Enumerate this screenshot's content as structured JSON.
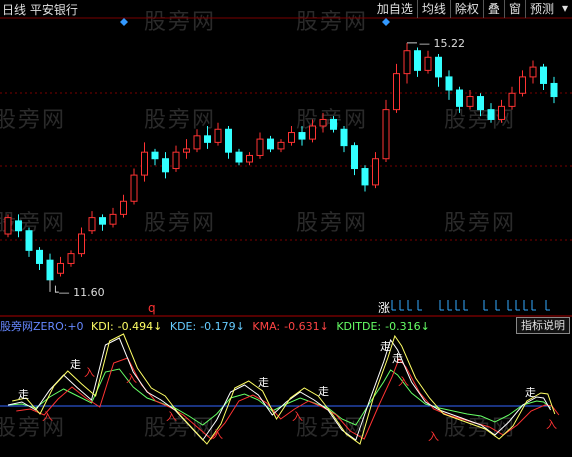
{
  "header": {
    "title": "日线  平安银行",
    "toolbar": [
      "加自选",
      "均线",
      "除权",
      "叠",
      "窗",
      "预测"
    ],
    "close_glyph": "▾"
  },
  "watermark_text": "股旁网",
  "price_labels": {
    "high": "15.22",
    "low": "11.60"
  },
  "markers": {
    "q_label": "q",
    "zhang_label": "涨"
  },
  "indicator": {
    "name": "股旁网ZERO:",
    "zero_value": "+0",
    "items": [
      {
        "label": "KDI:",
        "value": "-0.494",
        "arrow": "↓",
        "color": "#ffff66"
      },
      {
        "label": "KDE:",
        "value": "-0.179",
        "arrow": "↓",
        "color": "#66ccff"
      },
      {
        "label": "KMA:",
        "value": "-0.631",
        "arrow": "↓",
        "color": "#ff4444"
      },
      {
        "label": "KDITDE:",
        "value": "-0.316",
        "arrow": "↓",
        "color": "#66ff66"
      }
    ],
    "help_button": "指标说明",
    "signal_labels": {
      "sell": "走",
      "buy": "入"
    }
  },
  "colors": {
    "up": "#ff3333",
    "down": "#33ffff",
    "grid": "#7a0000",
    "kdi": "#ffff66",
    "kde": "#ffffff",
    "kma": "#ff3333",
    "kditde": "#66ff66",
    "zero": "#3366ff"
  },
  "chart_data": {
    "type": "candlestick",
    "ylim": [
      11.2,
      15.6
    ],
    "annotations": [
      {
        "text": "15.22",
        "value": 15.22
      },
      {
        "text": "11.60",
        "value": 11.6
      }
    ],
    "candles": [
      [
        12.3,
        12.55,
        12.25,
        12.6
      ],
      [
        12.5,
        12.35,
        12.25,
        12.6
      ],
      [
        12.35,
        12.05,
        11.95,
        12.4
      ],
      [
        12.05,
        11.85,
        11.75,
        12.1
      ],
      [
        11.9,
        11.6,
        11.6,
        12.0
      ],
      [
        11.7,
        11.85,
        11.65,
        11.95
      ],
      [
        11.85,
        12.0,
        11.8,
        12.05
      ],
      [
        12.0,
        12.3,
        11.95,
        12.4
      ],
      [
        12.35,
        12.55,
        12.3,
        12.65
      ],
      [
        12.55,
        12.45,
        12.35,
        12.6
      ],
      [
        12.45,
        12.6,
        12.4,
        12.7
      ],
      [
        12.6,
        12.8,
        12.55,
        12.9
      ],
      [
        12.8,
        13.2,
        12.75,
        13.3
      ],
      [
        13.2,
        13.55,
        13.1,
        13.7
      ],
      [
        13.55,
        13.45,
        13.35,
        13.6
      ],
      [
        13.45,
        13.25,
        13.15,
        13.55
      ],
      [
        13.3,
        13.55,
        13.25,
        13.65
      ],
      [
        13.55,
        13.6,
        13.45,
        13.75
      ],
      [
        13.6,
        13.8,
        13.55,
        13.9
      ],
      [
        13.8,
        13.7,
        13.6,
        13.95
      ],
      [
        13.7,
        13.9,
        13.65,
        14.0
      ],
      [
        13.9,
        13.55,
        13.45,
        13.95
      ],
      [
        13.55,
        13.4,
        13.35,
        13.6
      ],
      [
        13.4,
        13.5,
        13.35,
        13.55
      ],
      [
        13.5,
        13.75,
        13.45,
        13.85
      ],
      [
        13.75,
        13.6,
        13.55,
        13.8
      ],
      [
        13.6,
        13.7,
        13.55,
        13.75
      ],
      [
        13.7,
        13.85,
        13.65,
        13.95
      ],
      [
        13.85,
        13.75,
        13.65,
        13.95
      ],
      [
        13.75,
        13.95,
        13.7,
        14.05
      ],
      [
        13.95,
        14.05,
        13.85,
        14.15
      ],
      [
        14.05,
        13.9,
        13.85,
        14.1
      ],
      [
        13.9,
        13.65,
        13.55,
        13.95
      ],
      [
        13.65,
        13.3,
        13.2,
        13.7
      ],
      [
        13.3,
        13.05,
        12.95,
        13.35
      ],
      [
        13.05,
        13.45,
        13.0,
        13.55
      ],
      [
        13.45,
        14.2,
        13.4,
        14.35
      ],
      [
        14.2,
        14.75,
        14.15,
        14.9
      ],
      [
        14.75,
        15.1,
        14.6,
        15.22
      ],
      [
        15.1,
        14.8,
        14.7,
        15.15
      ],
      [
        14.8,
        15.0,
        14.75,
        15.1
      ],
      [
        15.0,
        14.7,
        14.55,
        15.05
      ],
      [
        14.7,
        14.5,
        14.35,
        14.8
      ],
      [
        14.5,
        14.25,
        14.15,
        14.55
      ],
      [
        14.25,
        14.4,
        14.2,
        14.5
      ],
      [
        14.4,
        14.2,
        14.1,
        14.45
      ],
      [
        14.2,
        14.05,
        14.0,
        14.3
      ],
      [
        14.05,
        14.25,
        14.0,
        14.35
      ],
      [
        14.25,
        14.45,
        14.2,
        14.55
      ],
      [
        14.45,
        14.7,
        14.4,
        14.8
      ],
      [
        14.7,
        14.85,
        14.6,
        14.95
      ],
      [
        14.85,
        14.6,
        14.5,
        14.9
      ],
      [
        14.6,
        14.4,
        14.3,
        14.7
      ]
    ]
  }
}
